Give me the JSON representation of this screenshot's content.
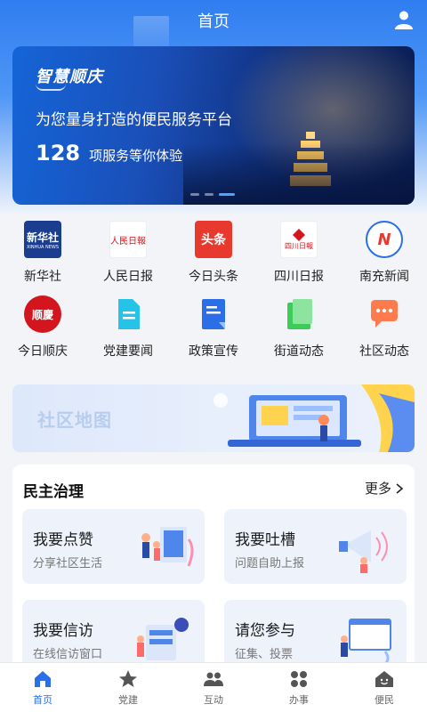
{
  "header": {
    "title": "首页"
  },
  "banner": {
    "logo_text": "智慧顺庆",
    "subtitle": "为您量身打造的便民服务平台",
    "count": "128",
    "count_text": "项服务等你体验"
  },
  "news": [
    {
      "label": "新华社",
      "logo_text": "新华社",
      "logo_sub": "XINHUA NEWS"
    },
    {
      "label": "人民日报",
      "logo_text": "人民日報"
    },
    {
      "label": "今日头条",
      "logo_text": "头条"
    },
    {
      "label": "四川日报",
      "logo_text": "四川日報"
    },
    {
      "label": "南充新闻",
      "logo_text": "N"
    },
    {
      "label": "今日顺庆",
      "logo_text": "顺慶"
    },
    {
      "label": "党建要闻"
    },
    {
      "label": "政策宣传"
    },
    {
      "label": "街道动态"
    },
    {
      "label": "社区动态"
    }
  ],
  "map_banner": {
    "title": "社区地图"
  },
  "governance": {
    "title": "民主治理",
    "more": "更多",
    "cards": [
      {
        "title": "我要点赞",
        "subtitle": "分享社区生活"
      },
      {
        "title": "我要吐槽",
        "subtitle": "问题自助上报"
      },
      {
        "title": "我要信访",
        "subtitle": "在线信访窗口"
      },
      {
        "title": "请您参与",
        "subtitle": "征集、投票"
      }
    ]
  },
  "tabs": [
    {
      "label": "首页",
      "active": true
    },
    {
      "label": "党建"
    },
    {
      "label": "互动"
    },
    {
      "label": "办事"
    },
    {
      "label": "便民"
    }
  ],
  "colors": {
    "primary": "#2a6fe8",
    "banner_dark": "#0e2a73",
    "card_bg": "#eef2fa"
  }
}
